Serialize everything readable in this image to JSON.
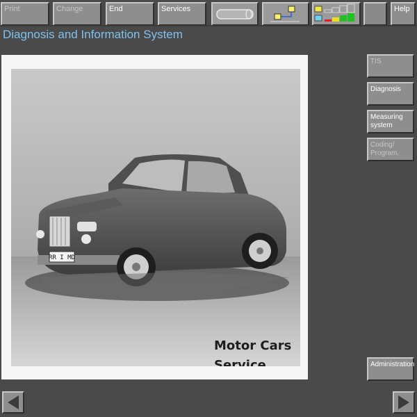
{
  "toolbar": {
    "print": "Print",
    "change": "Change",
    "end": "End",
    "services": "Services",
    "help": "Help"
  },
  "header": {
    "title": "Diagnosis and Information System"
  },
  "sidebar": {
    "tis": "TIS",
    "diagnosis": "Diagnosis",
    "measuring_line1": "Measuring",
    "measuring_line2": "system",
    "coding_line1": "Coding/",
    "coding_line2": "Program.",
    "administration": "Administration"
  },
  "main": {
    "caption_line1": "Motor Cars",
    "caption_line2": "Service",
    "plate": "RR I MD"
  },
  "icons": {
    "battery": "battery-icon",
    "network": "network-connection-icon",
    "signal": "signal-strength-icon",
    "back": "back-arrow-icon",
    "forward": "forward-arrow-icon"
  },
  "colors": {
    "title_text": "#7fc1ef",
    "background": "#4a4a4a",
    "button_face": "#8e8e8e"
  }
}
